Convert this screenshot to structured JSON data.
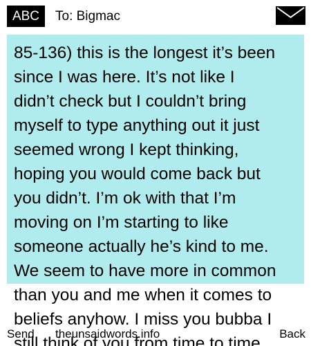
{
  "header": {
    "input_mode": "ABC",
    "to_label": "To: Bigmac",
    "icon": "envelope-icon"
  },
  "message": {
    "lines": [
      "85-136) this is the longest it’s been",
      "since I was here. It’s not like I",
      "didn’t check but I couldn’t bring",
      "myself to type anything out it just",
      "seemed wrong I kept thinking,",
      "hoping you would come back but",
      "you didn’t. I’m ok with that I’m",
      "moving on I’m starting to like",
      "someone actually he’s kind to me.",
      "We seem to have more in common",
      "than you and me when it comes to",
      "beliefs anyhow. I miss you bubba I",
      "still think of you from time to time"
    ],
    "highlight_color": "#b0ebee"
  },
  "footer": {
    "left_softkey": "Send",
    "site": "theunsaidwords.info",
    "right_softkey": "Back"
  }
}
